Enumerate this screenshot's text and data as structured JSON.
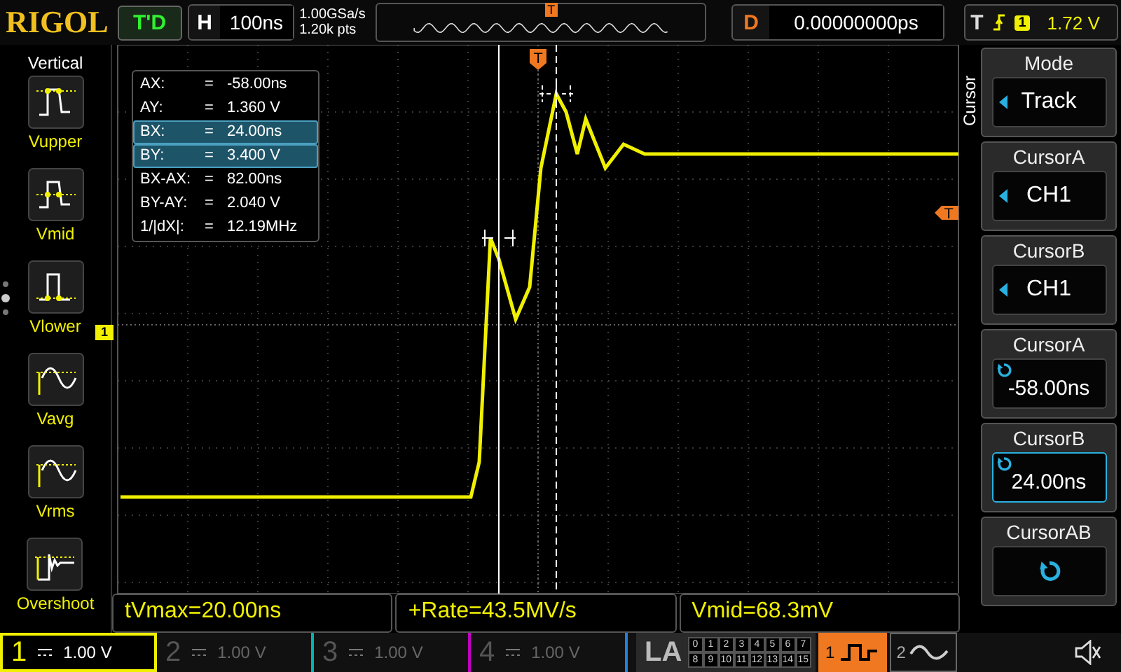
{
  "brand": "RIGOL",
  "run_status": "T'D",
  "horizontal": {
    "label": "H",
    "timebase": "100ns",
    "sample_rate": "1.00GSa/s",
    "memory_depth": "1.20k pts",
    "trigger_mark": "T"
  },
  "delay": {
    "label": "D",
    "value": "0.00000000ps"
  },
  "trigger": {
    "label": "T",
    "source": "1",
    "level": "1.72 V"
  },
  "left_menu": {
    "title": "Vertical",
    "items": [
      {
        "label": "Vupper",
        "kind": "upper"
      },
      {
        "label": "Vmid",
        "kind": "mid"
      },
      {
        "label": "Vlower",
        "kind": "lower"
      },
      {
        "label": "Vavg",
        "kind": "avg"
      },
      {
        "label": "Vrms",
        "kind": "rms"
      },
      {
        "label": "Overshoot",
        "kind": "overshoot"
      }
    ]
  },
  "screen": {
    "trigger_position_mark": "T",
    "trigger_level_mark": "T",
    "channel_mark": "1"
  },
  "cursor_readout": [
    {
      "name": "AX:",
      "equals": "=",
      "value": "-58.00ns",
      "selected": false
    },
    {
      "name": "AY:",
      "equals": "=",
      "value": "1.360 V",
      "selected": false
    },
    {
      "name": "BX:",
      "equals": "=",
      "value": "24.00ns",
      "selected": true
    },
    {
      "name": "BY:",
      "equals": "=",
      "value": "3.400 V",
      "selected": true
    },
    {
      "name": "BX-AX:",
      "equals": "=",
      "value": "82.00ns",
      "selected": false
    },
    {
      "name": "BY-AY:",
      "equals": "=",
      "value": "2.040 V",
      "selected": false
    },
    {
      "name": "1/|dX|:",
      "equals": "=",
      "value": "12.19MHz",
      "selected": false
    }
  ],
  "right_menu": {
    "title": "Cursor",
    "items": [
      {
        "kind": "select",
        "label": "Mode",
        "value": "Track",
        "selected": false
      },
      {
        "kind": "select",
        "label": "CursorA",
        "value": "CH1",
        "selected": false
      },
      {
        "kind": "select",
        "label": "CursorB",
        "value": "CH1",
        "selected": false
      },
      {
        "kind": "knob",
        "label": "CursorA",
        "value": "-58.00ns",
        "selected": false
      },
      {
        "kind": "knob",
        "label": "CursorB",
        "value": "24.00ns",
        "selected": true
      },
      {
        "kind": "knob",
        "label": "CursorAB",
        "selected": false
      }
    ]
  },
  "measurements": [
    "tVmax=20.00ns",
    "+Rate=43.5MV/s",
    "Vmid=68.3mV"
  ],
  "channels": [
    {
      "number": "1",
      "scale": "1.00 V",
      "on": true,
      "color": "#f0f000"
    },
    {
      "number": "2",
      "scale": "1.00 V",
      "on": false,
      "color": "#00b4b4"
    },
    {
      "number": "3",
      "scale": "1.00 V",
      "on": false,
      "color": "#c000c0"
    },
    {
      "number": "4",
      "scale": "1.00 V",
      "on": false,
      "color": "#2080e0"
    }
  ],
  "la": {
    "label": "LA",
    "digits": [
      "0",
      "1",
      "2",
      "3",
      "4",
      "5",
      "6",
      "7",
      "8",
      "9",
      "10",
      "11",
      "12",
      "13",
      "14",
      "15"
    ]
  },
  "sources": [
    {
      "number": "1",
      "selected": true
    },
    {
      "number": "2",
      "selected": false
    }
  ]
}
